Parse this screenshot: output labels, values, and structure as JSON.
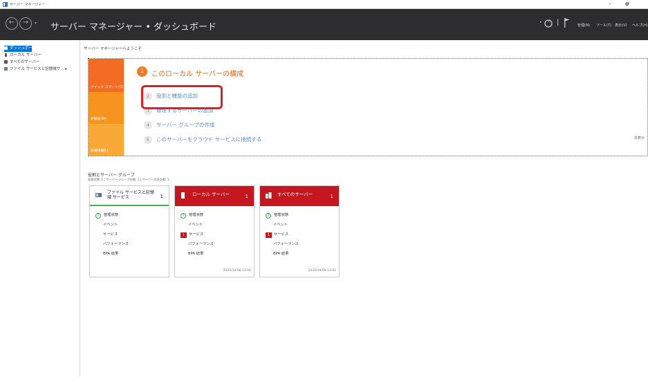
{
  "window": {
    "title": "サーバー マネージャー",
    "controls": [
      "–",
      "σ",
      ""
    ]
  },
  "header": {
    "breadcrumb": "サーバー マネージャー • ダッシュボード",
    "refresh_icon": "refresh-icon",
    "flag_icon": "flag-icon",
    "menus": [
      "管理(M)",
      "ツール(T)",
      "表示(V)",
      "ヘルプ(H)"
    ]
  },
  "sidebar": {
    "items": [
      {
        "label": "ダッシュボード",
        "icon": "dashboard-icon",
        "active": true
      },
      {
        "label": "ローカル サーバー",
        "icon": "server-icon",
        "active": false
      },
      {
        "label": "すべてのサーバー",
        "icon": "servers-icon",
        "active": false
      },
      {
        "label": "ファイル サービスと記憶域サ...",
        "icon": "file-services-icon",
        "active": false
      }
    ]
  },
  "welcome": "サーバー マネージャーへようこそ",
  "quick_start": {
    "tabs": [
      {
        "label": "クイック スタート(Q)",
        "color": "#f26d23"
      },
      {
        "label": "新機能(W)",
        "color": "#f7941d"
      },
      {
        "label": "詳細情報(L)",
        "color": "#f8a835"
      }
    ],
    "step1_number": "1",
    "step1_title": "このローカル サーバーの構成",
    "steps": [
      {
        "n": "2",
        "label": "役割と機能の追加"
      },
      {
        "n": "3",
        "label": "管理するサーバーの追加"
      },
      {
        "n": "4",
        "label": "サーバー グループの作成"
      },
      {
        "n": "5",
        "label": "このサーバーをクラウド サービスに接続する"
      }
    ],
    "hide_label": "非表示"
  },
  "groups_section": {
    "title": "役割とサーバー グループ",
    "subtitle": "役割の数: 1 | サーバー グループの数: 1 | サーバーの合計数: 1"
  },
  "cards": [
    {
      "title": "ファイル サービスと記憶域 サービス",
      "count": "1",
      "head_style": "white",
      "rows": [
        "管理状態",
        "イベント",
        "サービス",
        "パフォーマンス",
        "BPA 結果"
      ],
      "timestamp": ""
    },
    {
      "title": "ローカル サーバー",
      "count": "1",
      "head_style": "red",
      "rows": [
        "管理状態",
        "イベント",
        "サービス",
        "パフォーマンス",
        "BPA 結果"
      ],
      "service_badge": "1",
      "timestamp": "2020/10/08 13:02"
    },
    {
      "title": "すべてのサーバー",
      "count": "1",
      "head_style": "red",
      "rows": [
        "管理状態",
        "イベント",
        "サービス",
        "パフォーマンス",
        "BPA 結果"
      ],
      "service_badge": "1",
      "timestamp": "2020/10/08 13:02"
    }
  ],
  "colors": {
    "header_bg": "#2d2d30",
    "accent_blue": "#0078d7",
    "alert_red": "#c4171f",
    "ok_green": "#2f9e44",
    "highlight_red": "#e02020"
  }
}
